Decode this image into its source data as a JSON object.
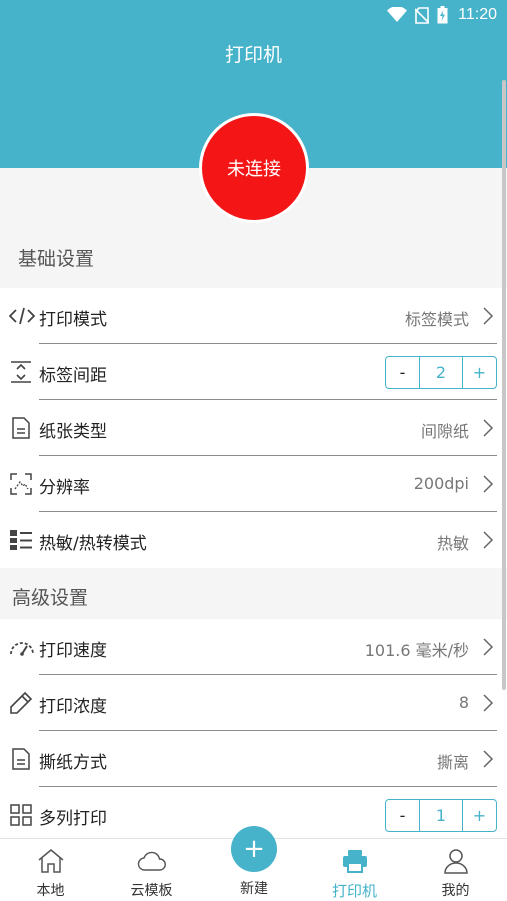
{
  "status_bar": {
    "time": "11:20"
  },
  "header": {
    "title": "打印机"
  },
  "connect_button": {
    "label": "未连接"
  },
  "basic_section": {
    "title": "基础设置",
    "print_mode": {
      "label": "打印模式",
      "value": "标签模式"
    },
    "label_gap": {
      "label": "标签间距",
      "minus": "-",
      "value": "2",
      "plus": "+"
    },
    "paper_type": {
      "label": "纸张类型",
      "value": "间隙纸"
    },
    "resolution": {
      "label": "分辨率",
      "value": "200dpi"
    },
    "thermal_mode": {
      "label": "热敏/热转模式",
      "value": "热敏"
    }
  },
  "advanced_section": {
    "title": "高级设置",
    "print_speed": {
      "label": "打印速度",
      "value": "101.6 毫米/秒"
    },
    "print_density": {
      "label": "打印浓度",
      "value": "8"
    },
    "tear_mode": {
      "label": "撕纸方式",
      "value": "撕离"
    },
    "multi_column": {
      "label": "多列打印",
      "minus": "-",
      "value": "1",
      "plus": "+"
    }
  },
  "tabbar": {
    "local": "本地",
    "cloud_templates": "云模板",
    "new": "新建",
    "new_symbol": "+",
    "printer": "打印机",
    "mine": "我的"
  },
  "colors": {
    "accent": "#47b3cb",
    "disconnected": "#f41517",
    "background": "#f5f5f5"
  }
}
